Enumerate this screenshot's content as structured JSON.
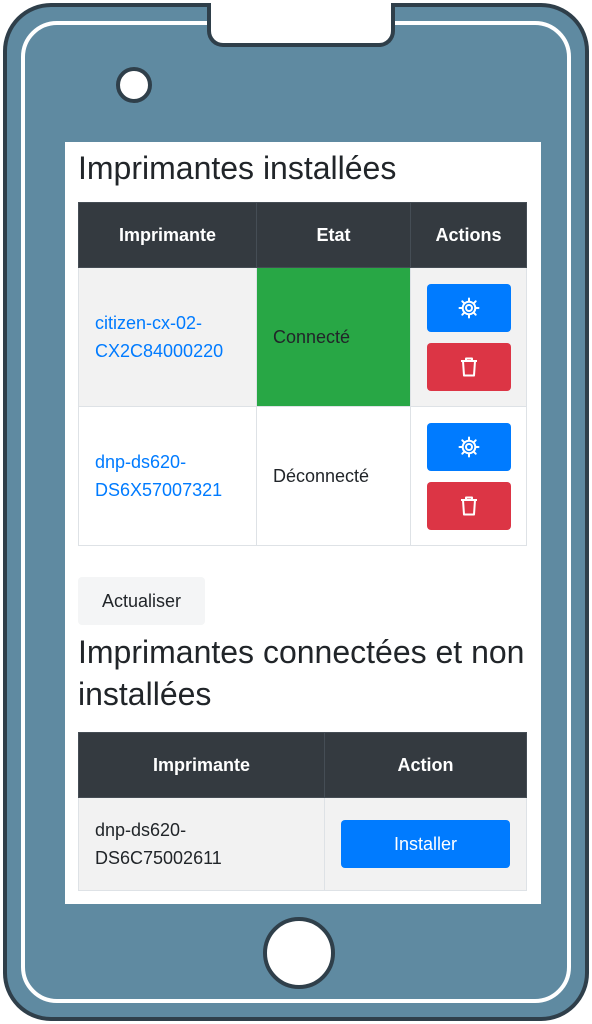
{
  "installed": {
    "title": "Imprimantes installées",
    "columns": [
      "Imprimante",
      "Etat",
      "Actions"
    ],
    "rows": [
      {
        "name": "citizen-cx-02-CX2C84000220",
        "status": "Connecté"
      },
      {
        "name": "dnp-ds620-DS6X57007321",
        "status": "Déconnecté"
      }
    ]
  },
  "refresh_label": "Actualiser",
  "uninstalled": {
    "title": "Imprimantes connectées et non installées",
    "columns": [
      "Imprimante",
      "Action"
    ],
    "rows": [
      {
        "name": "dnp-ds620-DS6C75002611",
        "action_label": "Installer"
      }
    ]
  },
  "colors": {
    "connected": "#28a745",
    "primary": "#007bff",
    "danger": "#dc3545",
    "header_bg": "#343a40",
    "phone_body": "#5f8aa1"
  },
  "icons": {
    "settings": "gear-icon",
    "delete": "trash-icon"
  }
}
